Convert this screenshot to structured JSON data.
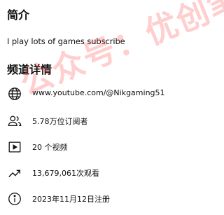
{
  "about": {
    "title": "简介",
    "description": "I play lots of games subscribe"
  },
  "details": {
    "title": "频道详情",
    "rows": [
      {
        "icon": "globe-icon",
        "text": "www.youtube.com/@Nikgaming51"
      },
      {
        "icon": "subscribers-icon",
        "text": "5.78万位订阅者"
      },
      {
        "icon": "video-icon",
        "text": "20 个视频"
      },
      {
        "icon": "trending-icon",
        "text": "13,679,061次观看"
      },
      {
        "icon": "info-icon",
        "text": "2023年11月12日注册"
      }
    ]
  },
  "watermark": "公众号：优创笔记",
  "colors": {
    "text": "#0f0f0f",
    "watermark": "#ff5050"
  }
}
